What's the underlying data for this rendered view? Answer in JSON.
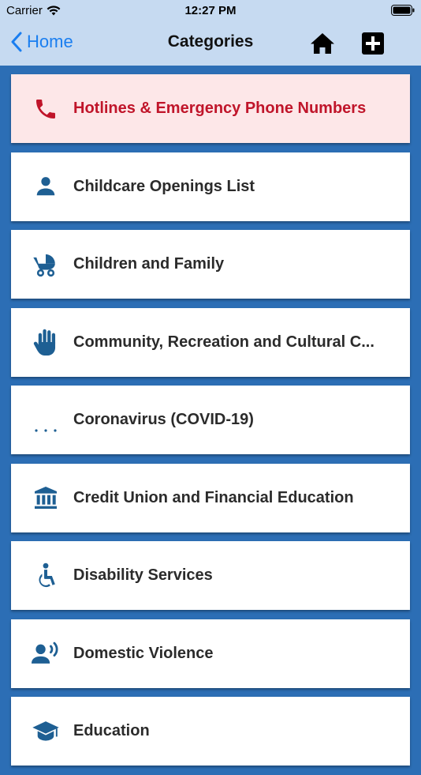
{
  "status_bar": {
    "carrier": "Carrier",
    "time": "12:27 PM"
  },
  "nav": {
    "back_label": "Home",
    "title": "Categories"
  },
  "colors": {
    "accent": "#1a7ef0",
    "icon_blue": "#1e5f93",
    "alert_red": "#c0152a",
    "alert_bg": "#fde7e8",
    "page_bg": "#2c6eb5",
    "header_bg": "#c6daf1"
  },
  "categories": [
    {
      "label": "Hotlines & Emergency Phone Numbers",
      "icon": "phone-icon"
    },
    {
      "label": "Childcare Openings List",
      "icon": "person-icon"
    },
    {
      "label": "Children and Family",
      "icon": "stroller-icon"
    },
    {
      "label": "Community, Recreation and Cultural C...",
      "icon": "hand-icon"
    },
    {
      "label": "Coronavirus (COVID-19)",
      "icon": "ellipsis-icon"
    },
    {
      "label": "Credit Union and Financial Education",
      "icon": "bank-icon"
    },
    {
      "label": "Disability Services",
      "icon": "accessibility-icon"
    },
    {
      "label": "Domestic Violence",
      "icon": "voice-icon"
    },
    {
      "label": "Education",
      "icon": "graduation-cap-icon"
    }
  ]
}
